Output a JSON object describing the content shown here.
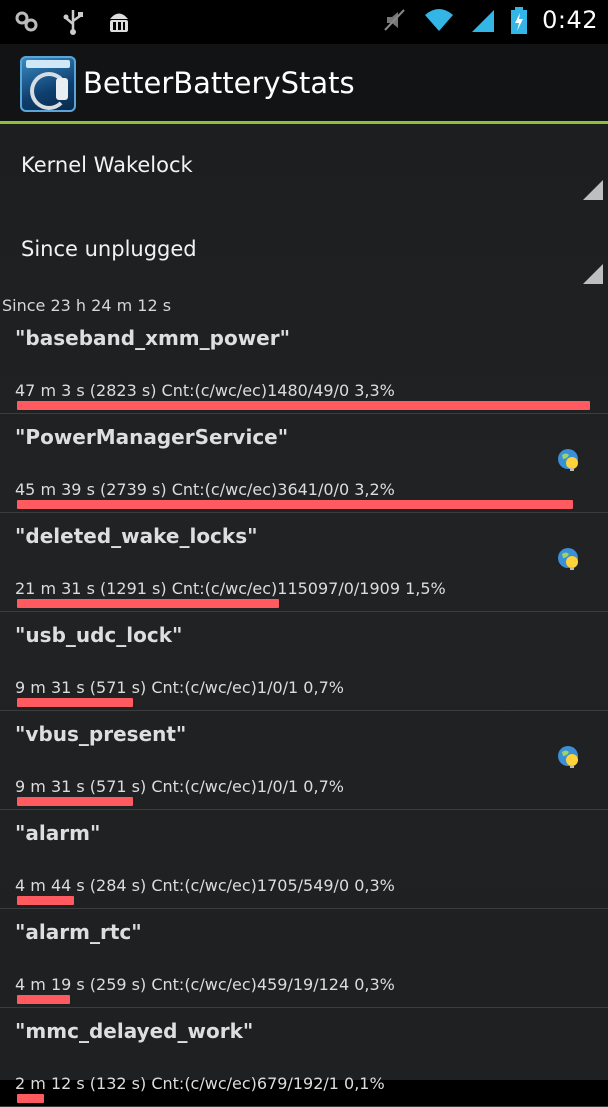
{
  "status_bar": {
    "time": "0:42",
    "left_icons": [
      "clover-icon",
      "usb-icon",
      "android-debug-icon"
    ],
    "right_icons": [
      "muted-speaker-icon",
      "wifi-icon",
      "signal-icon",
      "battery-charging-icon"
    ]
  },
  "action_bar": {
    "title": "BetterBatteryStats",
    "accent_color": "#8fbf3a"
  },
  "filters": {
    "stat_type": "Kernel Wakelock",
    "stat_period": "Since unplugged"
  },
  "since_label": "Since 23 h 24 m 12 s",
  "bar_color": "#ff5a5f",
  "rows": [
    {
      "name": "\"baseband_xmm_power\"",
      "detail": "47 m 3 s  (2823 s) Cnt:(c/wc/ec)1480/49/0 3,3%",
      "bar_fraction": 1.0,
      "has_badge": false
    },
    {
      "name": "\"PowerManagerService\"",
      "detail": "45 m 39 s  (2739 s) Cnt:(c/wc/ec)3641/0/0 3,2%",
      "bar_fraction": 0.97,
      "has_badge": true
    },
    {
      "name": "\"deleted_wake_locks\"",
      "detail": "21 m 31 s  (1291 s) Cnt:(c/wc/ec)115097/0/1909 1,5%",
      "bar_fraction": 0.457,
      "has_badge": true
    },
    {
      "name": "\"usb_udc_lock\"",
      "detail": "9 m 31 s  (571 s) Cnt:(c/wc/ec)1/0/1 0,7%",
      "bar_fraction": 0.202,
      "has_badge": false
    },
    {
      "name": "\"vbus_present\"",
      "detail": "9 m 31 s  (571 s) Cnt:(c/wc/ec)1/0/1 0,7%",
      "bar_fraction": 0.202,
      "has_badge": true
    },
    {
      "name": "\"alarm\"",
      "detail": "4 m 44 s  (284 s) Cnt:(c/wc/ec)1705/549/0 0,3%",
      "bar_fraction": 0.1,
      "has_badge": false
    },
    {
      "name": "\"alarm_rtc\"",
      "detail": "4 m 19 s  (259 s) Cnt:(c/wc/ec)459/19/124 0,3%",
      "bar_fraction": 0.092,
      "has_badge": false
    },
    {
      "name": "\"mmc_delayed_work\"",
      "detail": "2 m 12 s  (132 s) Cnt:(c/wc/ec)679/192/1 0,1%",
      "bar_fraction": 0.047,
      "has_badge": false
    }
  ]
}
